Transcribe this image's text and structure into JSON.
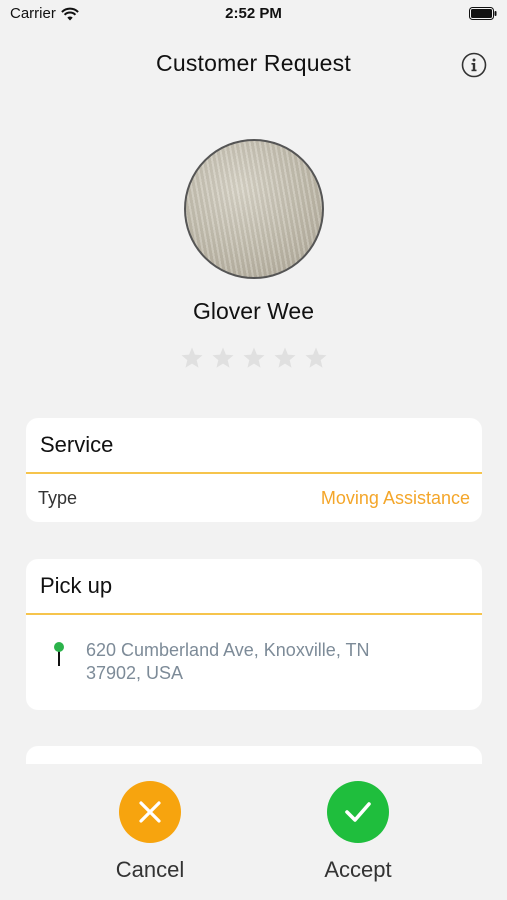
{
  "status_bar": {
    "carrier": "Carrier",
    "time": "2:52 PM",
    "wifi_icon": "wifi-icon",
    "battery_icon": "battery-icon"
  },
  "header": {
    "title": "Customer Request",
    "info_icon": "info-icon"
  },
  "customer": {
    "name": "Glover Wee",
    "rating": 0,
    "rating_max": 5
  },
  "service_card": {
    "title": "Service",
    "type_label": "Type",
    "type_value": "Moving Assistance"
  },
  "pickup_card": {
    "title": "Pick up",
    "address": "620 Cumberland Ave, Knoxville, TN 37902, USA",
    "pin_icon": "map-pin-icon"
  },
  "actions": {
    "cancel_label": "Cancel",
    "accept_label": "Accept",
    "cancel_icon": "close-icon",
    "accept_icon": "checkmark-icon"
  },
  "colors": {
    "accent": "#f4a62a",
    "divider": "#f6c44c",
    "cancel": "#f7a40e",
    "accept": "#1fbe3d",
    "pin": "#2bb34a",
    "star_empty": "#e0e0e0"
  }
}
